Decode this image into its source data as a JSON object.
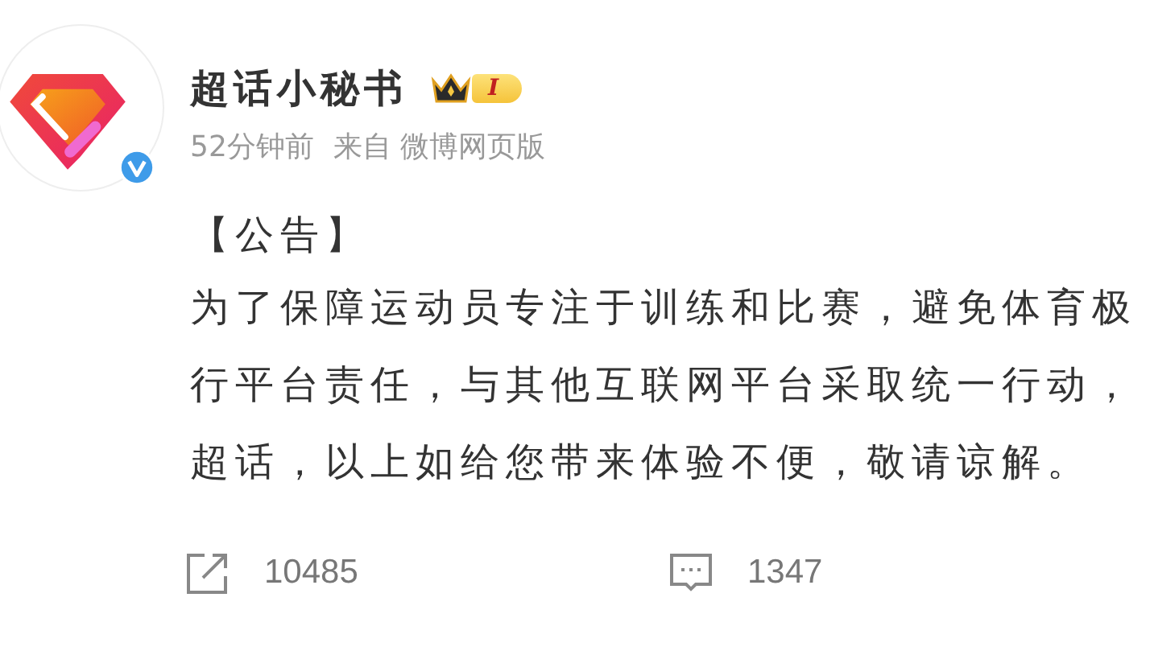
{
  "post": {
    "author": "超话小秘书",
    "badge_level": "I",
    "verified": true,
    "time": "52分钟前",
    "source": "来自 微博网页版",
    "paragraphs": [
      "【公告】",
      "为了保障运动员专注于训练和比赛，避免体育极",
      "行平台责任，与其他互联网平台采取统一行动，",
      "超话，以上如给您带来体验不便，敬请谅解。"
    ]
  },
  "actions": [
    {
      "kind": "share",
      "count": "10485"
    },
    {
      "kind": "comment",
      "count": "1347"
    }
  ]
}
